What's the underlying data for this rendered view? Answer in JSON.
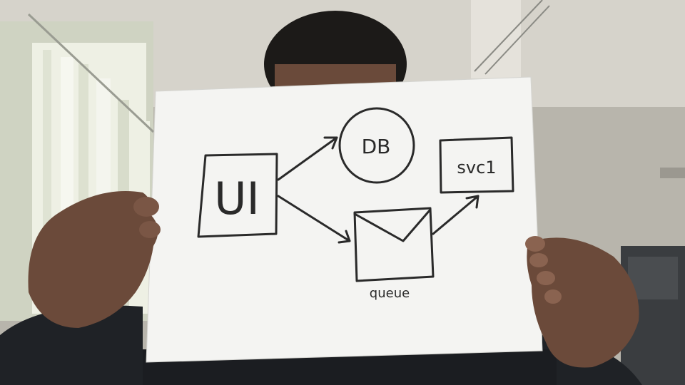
{
  "photo": {
    "description_free": true,
    "colors": {
      "wall": "#b9b6ad",
      "ceiling": "#d9d7cf",
      "window_light": "#eef0e6",
      "blinds": "#d6dac8",
      "paper": "#f4f4f2",
      "ink": "#2a2a2a",
      "skin": "#6b4a3a",
      "shirt": "#1f2226",
      "hair": "#1a1816"
    }
  },
  "sketch": {
    "ui_label": "UI",
    "db_label": "DB",
    "svc_label": "svc1",
    "queue_label": "queue",
    "icons": [
      "arrow-icon",
      "envelope-icon"
    ]
  }
}
